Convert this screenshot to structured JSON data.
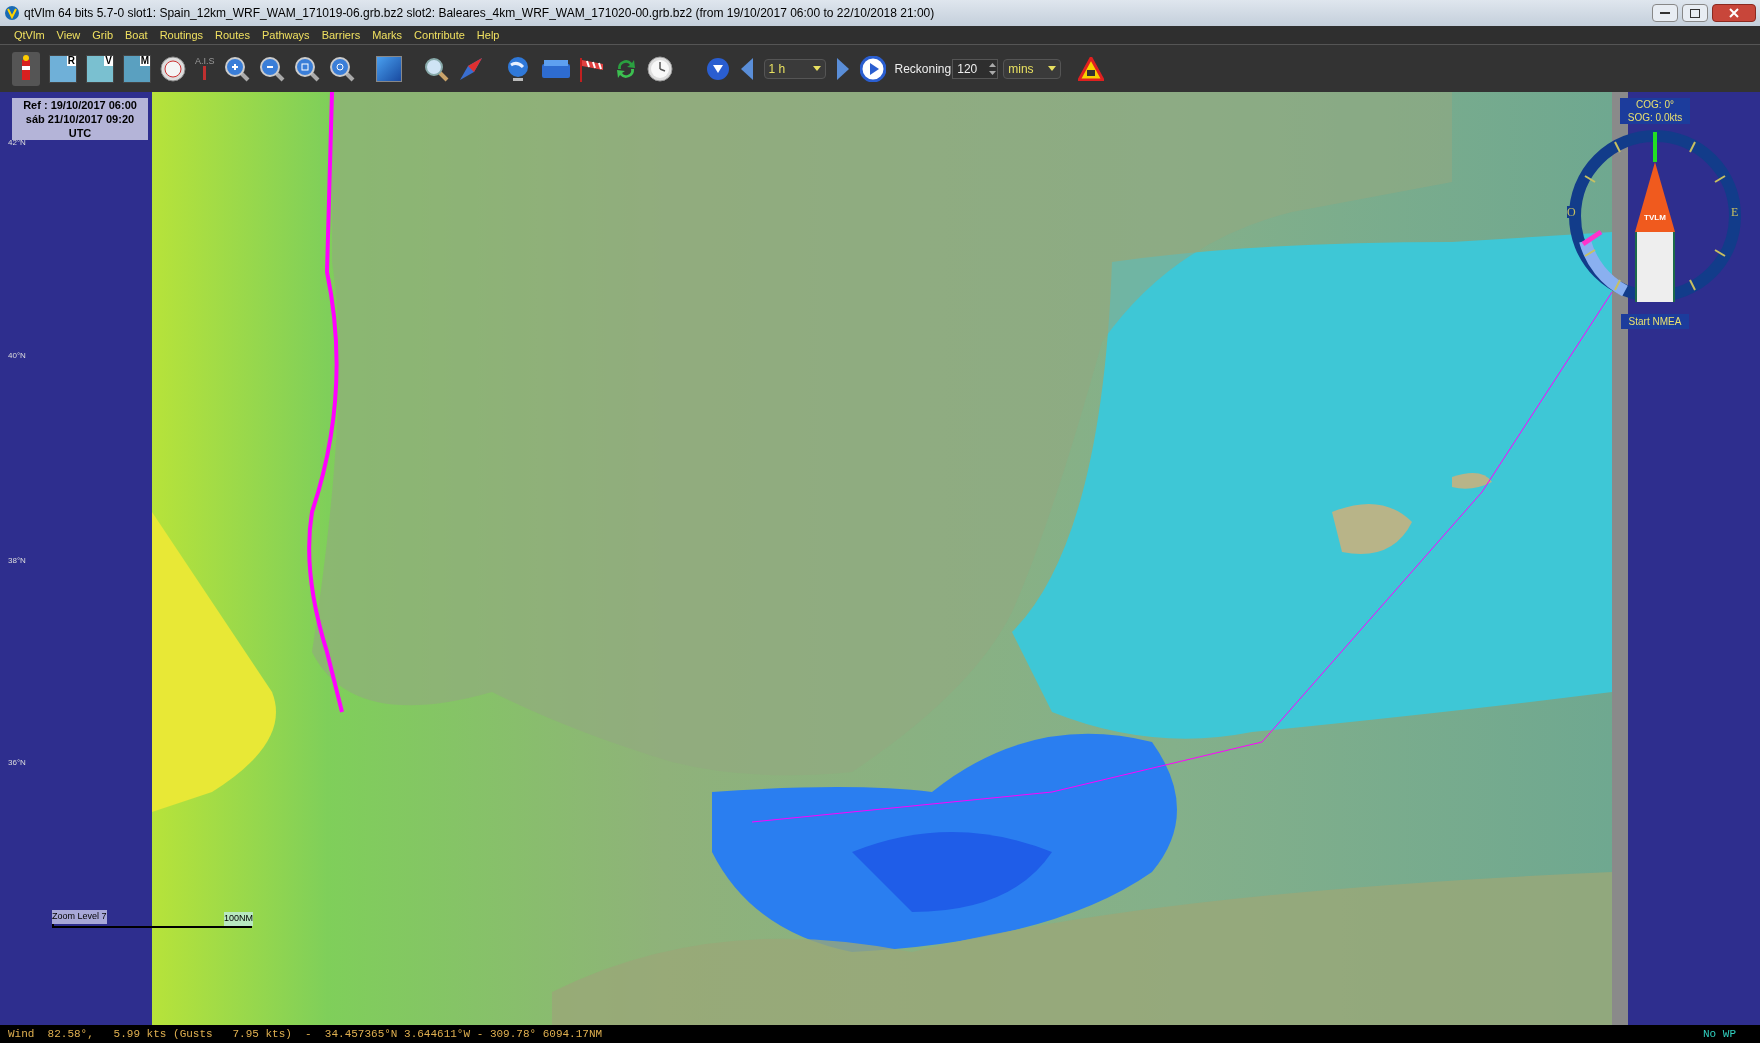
{
  "window": {
    "title": "qtVlm 64 bits 5.7-0 slot1: Spain_12km_WRF_WAM_171019-06.grb.bz2 slot2: Baleares_4km_WRF_WAM_171020-00.grb.bz2 (from 19/10/2017 06:00 to 22/10/2018 21:00)"
  },
  "menu": [
    "QtVlm",
    "View",
    "Grib",
    "Boat",
    "Routings",
    "Routes",
    "Pathways",
    "Barriers",
    "Marks",
    "Contribute",
    "Help"
  ],
  "toolbar": {
    "map_letters": [
      "R",
      "V",
      "M"
    ],
    "ais_label": "A.I.S",
    "step": "1 h",
    "reckoning_label": "Reckoning",
    "reckoning_value": "120",
    "reckoning_unit": "mins"
  },
  "map": {
    "ref_lines": [
      "Ref : 19/10/2017 06:00",
      "sáb 21/10/2017 09:20",
      "UTC"
    ],
    "latitudes": [
      "42°N",
      "40°N",
      "38°N",
      "36°N"
    ],
    "zoom_label": "Zoom Level 7",
    "scale_label": "100NM"
  },
  "boat": {
    "cog": "COG: 0°",
    "sog": "SOG: 0.0kts",
    "hull_text": "TVLM",
    "nmea_button": "Start NMEA",
    "compass_w": "O",
    "compass_e": "E"
  },
  "status_bar": {
    "info": "Wind  82.58°,   5.99 kts (Gusts   7.95 kts)  -  34.457365°N 3.644611°W - 309.78° 6094.17NM",
    "waypoint": "No WP"
  }
}
